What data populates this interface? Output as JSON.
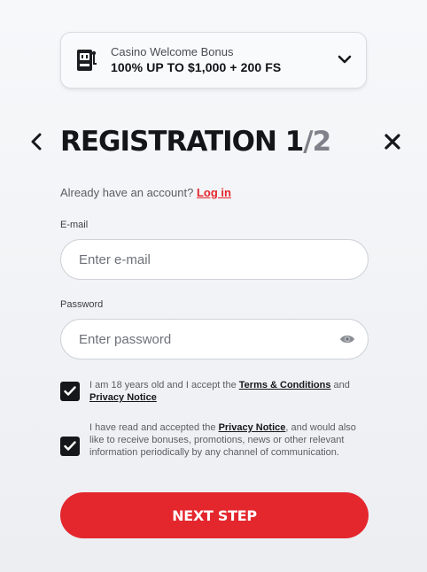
{
  "bonus": {
    "subtitle": "Casino Welcome Bonus",
    "title": "100% UP TO $1,000 + 200 FS",
    "icon": "slot-machine-icon"
  },
  "header": {
    "title_main": "REGISTRATION 1",
    "title_sep": "/",
    "title_total": "2"
  },
  "account": {
    "prompt": "Already have an account?",
    "login_label": "Log in"
  },
  "email": {
    "label": "E-mail",
    "placeholder": "Enter e-mail",
    "value": ""
  },
  "password": {
    "label": "Password",
    "placeholder": "Enter password",
    "value": ""
  },
  "consent_age": {
    "checked": true,
    "text_pre": "I am 18 years old and I accept the ",
    "terms_link": "Terms & Conditions",
    "text_mid": " and ",
    "privacy_link": "Privacy Notice"
  },
  "consent_marketing": {
    "checked": true,
    "text_pre": "I have read and accepted the ",
    "privacy_link": "Privacy Notice",
    "text_post": ", and would also like to receive bonuses, promotions, news or other relevant information periodically by any channel of communication."
  },
  "actions": {
    "next_label": "NEXT STEP"
  },
  "colors": {
    "accent": "#e4262d",
    "checkbox": "#16171a"
  }
}
